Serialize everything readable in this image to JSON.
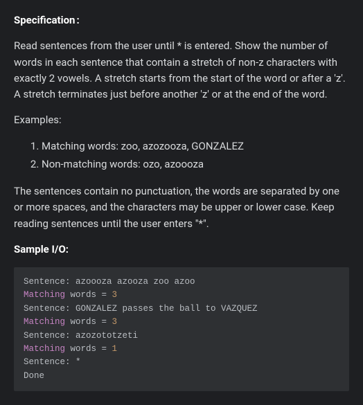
{
  "spec": {
    "heading": "Specification",
    "colon": ":",
    "paragraph1": "Read sentences from the user until * is entered. Show the number of words in each sentence that contain a stretch of non-z characters with exactly 2 vowels. A stretch starts from the start of the word or after a 'z'. A stretch terminates just before another 'z' or at the end of the word.",
    "examples_label": "Examples:",
    "examples": [
      "Matching words: zoo, azozooza, GONZALEZ",
      "Non-matching words: ozo, azoooza"
    ],
    "paragraph2": "The sentences contain no punctuation, the words are separated by one or more spaces, and the characters may be upper or lower case. Keep reading sentences until the user enters \"*\"."
  },
  "sample": {
    "heading": "Sample I/O:",
    "io_lines": [
      {
        "type": "prompt",
        "label": "Sentence: ",
        "input": "azoooza azooza zoo azoo"
      },
      {
        "type": "result",
        "kw": "Matching",
        "mid": " words ",
        "eq": "=",
        "val": " 3"
      },
      {
        "type": "prompt",
        "label": "Sentence: ",
        "input": "GONZALEZ passes the ball to VAZQUEZ"
      },
      {
        "type": "result",
        "kw": "Matching",
        "mid": " words ",
        "eq": "=",
        "val": " 3"
      },
      {
        "type": "prompt",
        "label": "Sentence: ",
        "input": "azozototzeti"
      },
      {
        "type": "result",
        "kw": "Matching",
        "mid": " words ",
        "eq": "=",
        "val": " 1"
      },
      {
        "type": "prompt",
        "label": "Sentence: ",
        "input": "*"
      },
      {
        "type": "done",
        "text": "Done"
      }
    ]
  }
}
